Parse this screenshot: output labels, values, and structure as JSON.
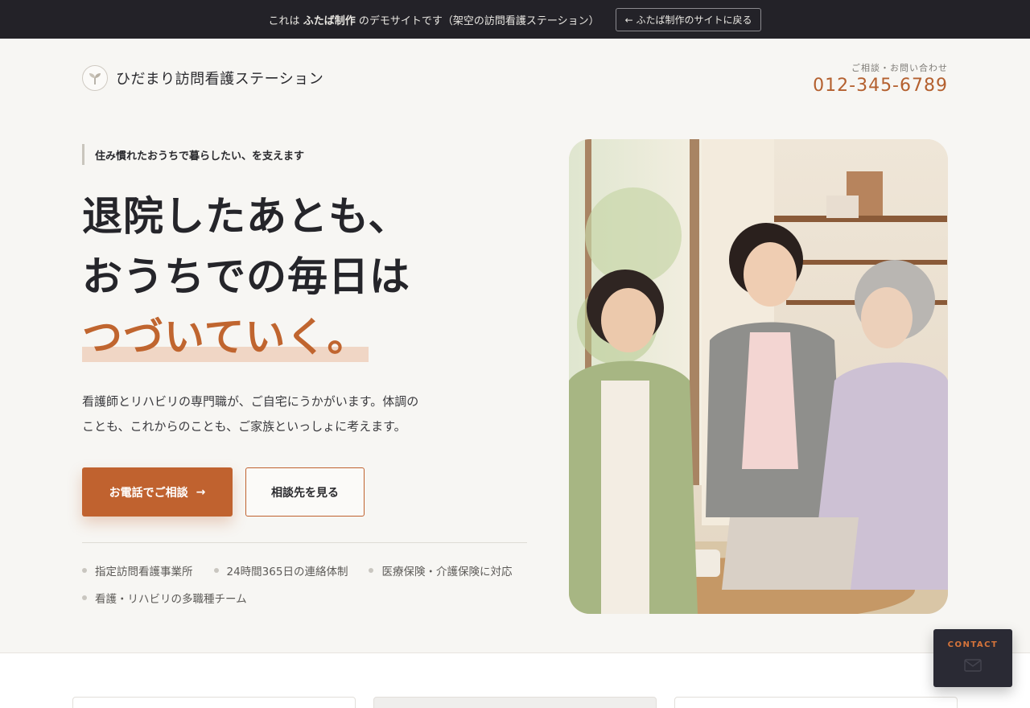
{
  "demo_bar": {
    "text_prefix": "これは",
    "text_brand": "ふたば制作",
    "text_suffix": "のデモサイトです（架空の訪問看護ステーション）",
    "back_label": "← ふたば制作のサイトに戻る"
  },
  "header": {
    "logo_name": "ひだまり訪問看護ステーション",
    "contact_label": "ご相談・お問い合わせ",
    "phone": "012-345-6789"
  },
  "hero": {
    "eyebrow": "住み慣れたおうちで暮らしたい、を支えます",
    "title_line1": "退院したあとも、",
    "title_line2": "おうちでの毎日は",
    "title_line3": "つづいていく。",
    "desc_line1": "看護師とリハビリの専門職が、ご自宅にうかがいます。体調の",
    "desc_line2": "ことも、これからのことも、ご家族といっしょに考えます。",
    "cta_primary": "お電話でご相談",
    "cta_primary_arrow": "→",
    "cta_secondary": "相談先を見る",
    "features": [
      "指定訪問看護事業所",
      "24時間365日の連絡体制",
      "医療保険・介護保険に対応",
      "看護・リハビリの多職種チーム"
    ]
  },
  "floating_contact": {
    "label": "CONTACT"
  },
  "colors": {
    "accent": "#c0622f",
    "topbar": "#232228",
    "background": "#f7f6f3"
  }
}
